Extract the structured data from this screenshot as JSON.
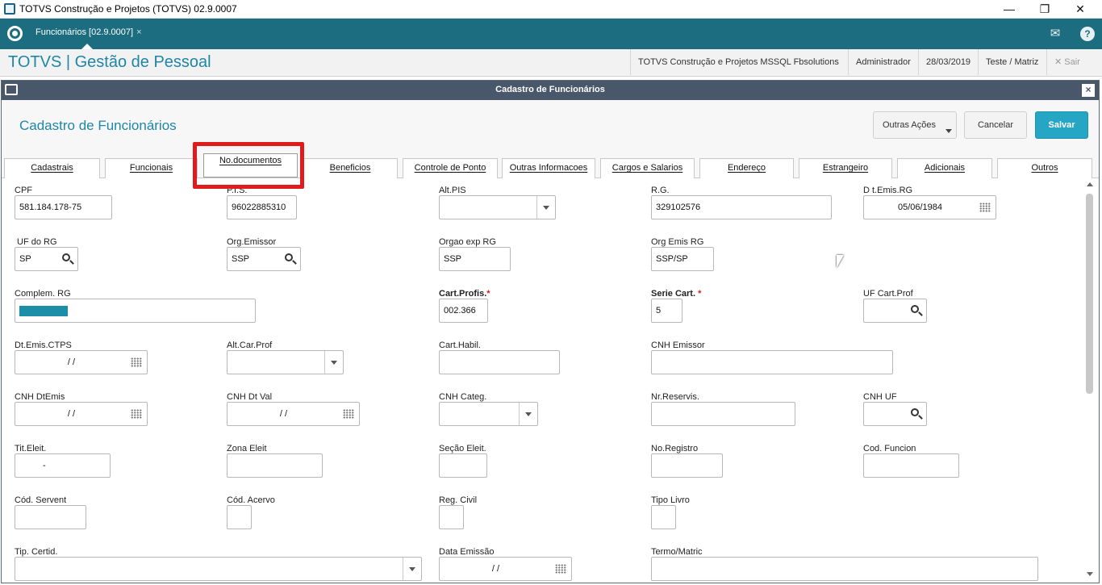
{
  "window": {
    "title": "TOTVS Construção e Projetos (TOTVS) 02.9.0007",
    "min": "—",
    "max": "❐",
    "close": "✕"
  },
  "topbar": {
    "tab_label": "Funcionários [02.9.0007]",
    "tab_close": "×",
    "mail_icon": "mail-icon",
    "help_icon": "?"
  },
  "header": {
    "brand": "TOTVS | Gestão de Pessoal",
    "company": "TOTVS Construção e Projetos MSSQL Fbsolutions",
    "user": "Administrador",
    "date": "28/03/2019",
    "branch": "Teste / Matriz",
    "exit": "✕  Sair"
  },
  "dialog": {
    "title": "Cadastro de Funcionários",
    "heading": "Cadastro de Funcionários",
    "buttons": {
      "more": "Outras Ações",
      "cancel": "Cancelar",
      "save": "Salvar"
    }
  },
  "tabs": [
    "Cadastrais",
    "Funcionais",
    "No.documentos",
    "Beneficios",
    "Controle de Ponto",
    "Outras Informacoes",
    "Cargos e Salarios",
    "Endereço",
    "Estrangeiro",
    "Adicionais",
    "Outros"
  ],
  "active_tab_index": 2,
  "form": {
    "cpf": {
      "label": "CPF",
      "value": "581.184.178-75"
    },
    "pis": {
      "label": "P.I.S.",
      "value": "96022885310"
    },
    "alt_pis": {
      "label": "Alt.PIS",
      "value": ""
    },
    "rg": {
      "label": "R.G.",
      "value": "329102576"
    },
    "dt_emis_rg": {
      "label": "D t.Emis.RG",
      "value": "05/06/1984"
    },
    "uf_rg": {
      "label": "UF do RG",
      "value": "SP"
    },
    "org_emissor": {
      "label": "Org.Emissor",
      "value": "SSP"
    },
    "orgao_exp_rg": {
      "label": "Orgao exp RG",
      "value": "SSP"
    },
    "org_emis_rg": {
      "label": "Org Emis RG",
      "value": "SSP/SP"
    },
    "complem_rg": {
      "label": "Complem. RG",
      "value": ""
    },
    "cart_profis": {
      "label": "Cart.Profis.",
      "required": "*",
      "value": "002.366"
    },
    "serie_cart": {
      "label": "Serie Cart.",
      "required": "*",
      "value": "5"
    },
    "uf_cart_prof": {
      "label": "UF Cart.Prof",
      "value": ""
    },
    "dt_emis_ctps": {
      "label": "Dt.Emis.CTPS",
      "value": "/  /"
    },
    "alt_car_prof": {
      "label": "Alt.Car.Prof",
      "value": ""
    },
    "cart_habil": {
      "label": "Cart.Habil.",
      "value": ""
    },
    "cnh_emissor": {
      "label": "CNH Emissor",
      "value": ""
    },
    "cnh_dtemis": {
      "label": "CNH DtEmis",
      "value": "/  /"
    },
    "cnh_dt_val": {
      "label": "CNH Dt Val",
      "value": "/  /"
    },
    "cnh_categ": {
      "label": "CNH Categ.",
      "value": ""
    },
    "nr_reservis": {
      "label": "Nr.Reservis.",
      "value": ""
    },
    "cnh_uf": {
      "label": "CNH UF",
      "value": ""
    },
    "tit_eleit": {
      "label": "Tit.Eleit.",
      "value": "-"
    },
    "zona_eleit": {
      "label": "Zona Eleit",
      "value": ""
    },
    "secao_eleit": {
      "label": "Seção Eleit.",
      "value": ""
    },
    "no_registro": {
      "label": "No.Registro",
      "value": ""
    },
    "cod_funcion": {
      "label": "Cod. Funcion",
      "value": ""
    },
    "cod_servent": {
      "label": "Cód. Servent",
      "value": ""
    },
    "cod_acervo": {
      "label": "Cód. Acervo",
      "value": ""
    },
    "reg_civil": {
      "label": "Reg. Civil",
      "value": ""
    },
    "tipo_livro": {
      "label": "Tipo Livro",
      "value": ""
    },
    "tip_certid": {
      "label": "Tip. Certid.",
      "value": ""
    },
    "data_emissao": {
      "label": "Data Emissão",
      "value": "/  /"
    },
    "termo_matric": {
      "label": "Termo/Matric",
      "value": ""
    }
  }
}
